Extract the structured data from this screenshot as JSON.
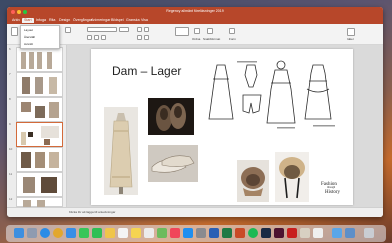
{
  "window": {
    "title": "Regency allmänt föreläsninger 2019"
  },
  "ribbon_tabs": [
    "Arkiv",
    "Start",
    "Infoga",
    "Rita",
    "Design",
    "Övergångar",
    "Animeringar",
    "Bildspel",
    "Granska",
    "Visa"
  ],
  "ribbon": {
    "buttons": [
      "Layout",
      "Återställ",
      "Avsnitt",
      "Ordna",
      "Snabbformat",
      "Form",
      "Idéer"
    ]
  },
  "dropdown": {
    "items": [
      "Layout",
      "Återställ",
      "Avsnitt"
    ]
  },
  "thumbnails": {
    "numbers": [
      "6",
      "7",
      "8",
      "9",
      "10",
      "11",
      "12"
    ],
    "selected_index": 3
  },
  "slide": {
    "title": "Dam – Lager",
    "logo_line1": "Fashion",
    "logo_line2": "through",
    "logo_line3": "History"
  },
  "statusbar": {
    "notes": "Klicka för att lägga till anteckningar"
  },
  "colors": {
    "accent": "#b7472a",
    "selection": "#d36a3a"
  }
}
